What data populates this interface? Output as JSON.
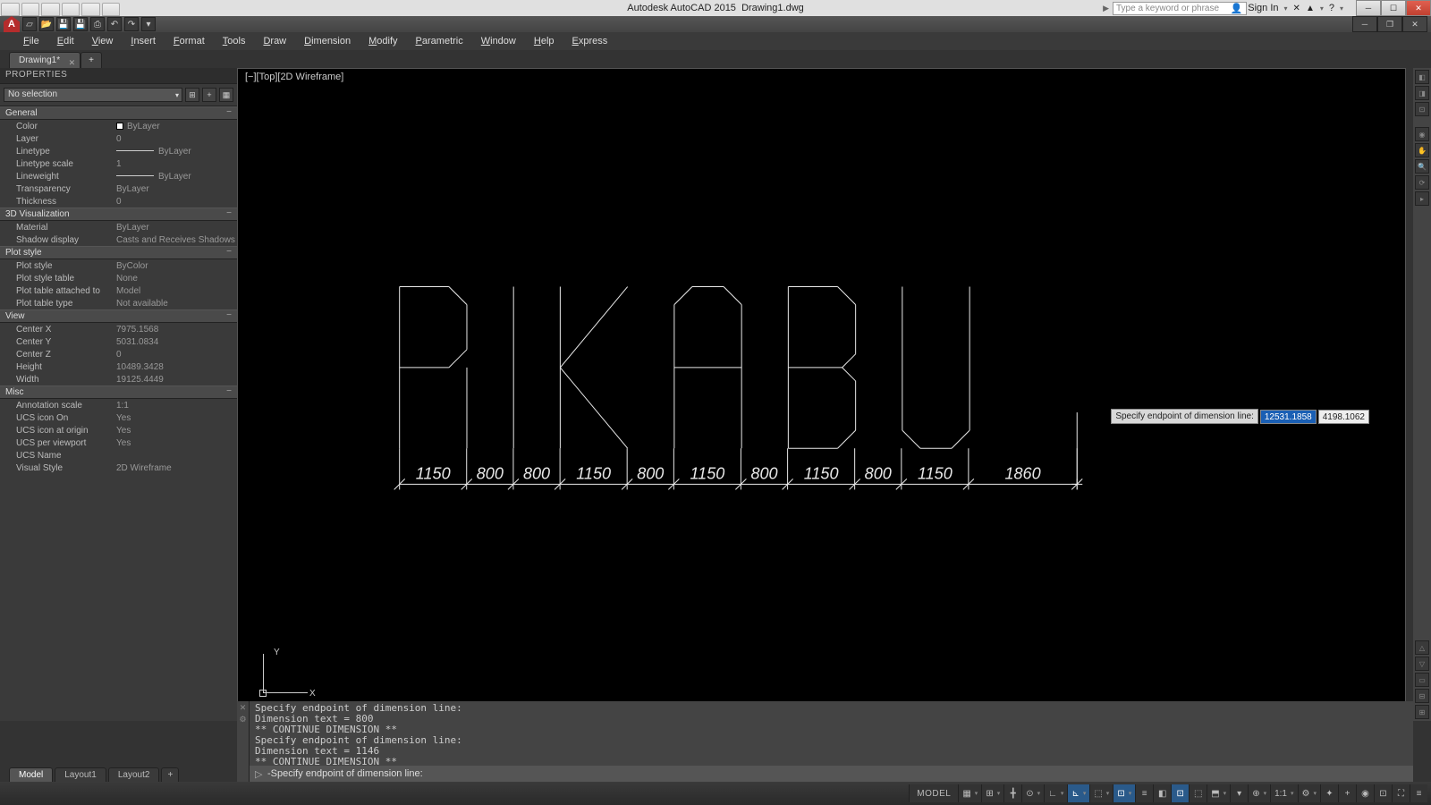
{
  "title": {
    "app": "Autodesk AutoCAD 2015",
    "file": "Drawing1.dwg"
  },
  "search_placeholder": "Type a keyword or phrase",
  "signin_label": "Sign In",
  "menus": [
    "File",
    "Edit",
    "View",
    "Insert",
    "Format",
    "Tools",
    "Draw",
    "Dimension",
    "Modify",
    "Parametric",
    "Window",
    "Help",
    "Express"
  ],
  "filetab": {
    "name": "Drawing1*",
    "add": "+"
  },
  "panel": {
    "title": "PROPERTIES",
    "selection": "No selection",
    "sections": {
      "general": {
        "label": "General",
        "rows": [
          {
            "k": "Color",
            "v": "ByLayer",
            "swatch": true
          },
          {
            "k": "Layer",
            "v": "0"
          },
          {
            "k": "Linetype",
            "v": "ByLayer",
            "line": true
          },
          {
            "k": "Linetype scale",
            "v": "1"
          },
          {
            "k": "Lineweight",
            "v": "ByLayer",
            "line": true
          },
          {
            "k": "Transparency",
            "v": "ByLayer"
          },
          {
            "k": "Thickness",
            "v": "0"
          }
        ]
      },
      "vis3d": {
        "label": "3D Visualization",
        "rows": [
          {
            "k": "Material",
            "v": "ByLayer"
          },
          {
            "k": "Shadow display",
            "v": "Casts and Receives Shadows"
          }
        ]
      },
      "plot": {
        "label": "Plot style",
        "rows": [
          {
            "k": "Plot style",
            "v": "ByColor"
          },
          {
            "k": "Plot style table",
            "v": "None"
          },
          {
            "k": "Plot table attached to",
            "v": "Model"
          },
          {
            "k": "Plot table type",
            "v": "Not available"
          }
        ]
      },
      "view": {
        "label": "View",
        "rows": [
          {
            "k": "Center X",
            "v": "7975.1568"
          },
          {
            "k": "Center Y",
            "v": "5031.0834"
          },
          {
            "k": "Center Z",
            "v": "0"
          },
          {
            "k": "Height",
            "v": "10489.3428"
          },
          {
            "k": "Width",
            "v": "19125.4449"
          }
        ]
      },
      "misc": {
        "label": "Misc",
        "rows": [
          {
            "k": "Annotation scale",
            "v": "1:1"
          },
          {
            "k": "UCS icon On",
            "v": "Yes"
          },
          {
            "k": "UCS icon at origin",
            "v": "Yes"
          },
          {
            "k": "UCS per viewport",
            "v": "Yes"
          },
          {
            "k": "UCS Name",
            "v": ""
          },
          {
            "k": "Visual Style",
            "v": "2D Wireframe"
          }
        ]
      }
    }
  },
  "viewport_label": "[−][Top][2D Wireframe]",
  "ucs": {
    "x": "X",
    "y": "Y"
  },
  "drawing": {
    "text": "PIKABU",
    "dims": [
      "1150",
      "800",
      "800",
      "1150",
      "800",
      "1150",
      "800",
      "1150",
      "800",
      "1150",
      "1860"
    ]
  },
  "dyn_input": {
    "prompt": "Specify endpoint of dimension line:",
    "val1": "12531.1858",
    "val2": "4198.1062"
  },
  "cmd_history": [
    "Specify endpoint of dimension line:",
    "Dimension text = 800",
    "** CONTINUE DIMENSION **",
    "Specify endpoint of dimension line:",
    "Dimension text = 1146",
    "** CONTINUE DIMENSION **"
  ],
  "cmd_prompt": "-Specify endpoint of dimension line:",
  "layout_tabs": {
    "model": "Model",
    "l1": "Layout1",
    "l2": "Layout2",
    "add": "+"
  },
  "status": {
    "model": "MODEL",
    "scale": "1:1"
  }
}
